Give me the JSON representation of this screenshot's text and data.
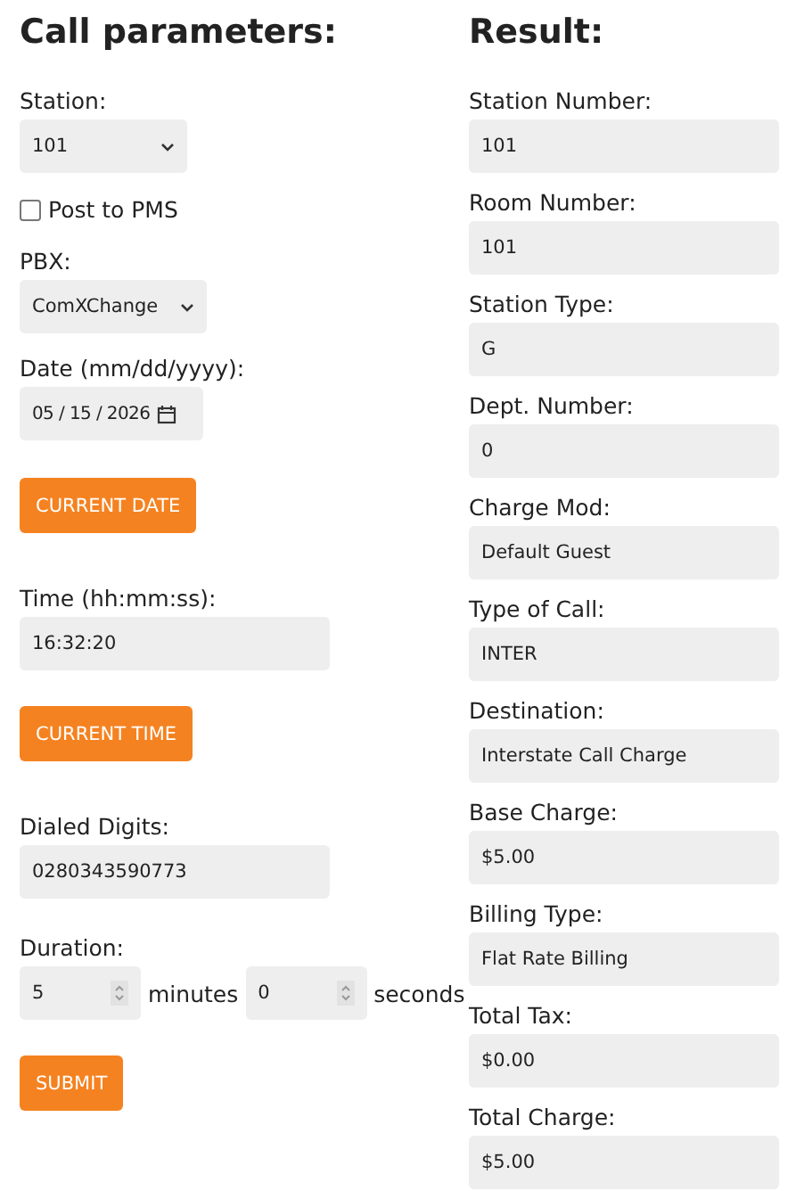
{
  "params": {
    "title": "Call parameters:",
    "station": {
      "label": "Station:",
      "value": "101"
    },
    "post_to_pms": {
      "label": "Post to PMS",
      "checked": false
    },
    "pbx": {
      "label": "PBX:",
      "value": "ComXChange"
    },
    "date": {
      "label": "Date (mm/dd/yyyy):",
      "value": "05 / 15 / 2026"
    },
    "current_date_button": "CURRENT DATE",
    "time": {
      "label": "Time (hh:mm:ss):",
      "value": "16:32:20"
    },
    "current_time_button": "CURRENT TIME",
    "dialed_digits": {
      "label": "Dialed Digits:",
      "value": "0280343590773"
    },
    "duration": {
      "label": "Duration:",
      "minutes": "5",
      "minutes_unit": "minutes",
      "seconds": "0",
      "seconds_unit": "seconds"
    },
    "submit_button": "SUBMIT"
  },
  "result": {
    "title": "Result:",
    "fields": [
      {
        "label": "Station Number:",
        "value": "101"
      },
      {
        "label": "Room Number:",
        "value": "101"
      },
      {
        "label": "Station Type:",
        "value": "G"
      },
      {
        "label": "Dept. Number:",
        "value": "0"
      },
      {
        "label": "Charge Mod:",
        "value": "Default Guest"
      },
      {
        "label": "Type of Call:",
        "value": "INTER"
      },
      {
        "label": "Destination:",
        "value": "Interstate Call Charge"
      },
      {
        "label": "Base Charge:",
        "value": "$5.00"
      },
      {
        "label": "Billing Type:",
        "value": "Flat Rate Billing"
      },
      {
        "label": "Total Tax:",
        "value": "$0.00"
      },
      {
        "label": "Total Charge:",
        "value": "$5.00"
      }
    ]
  }
}
